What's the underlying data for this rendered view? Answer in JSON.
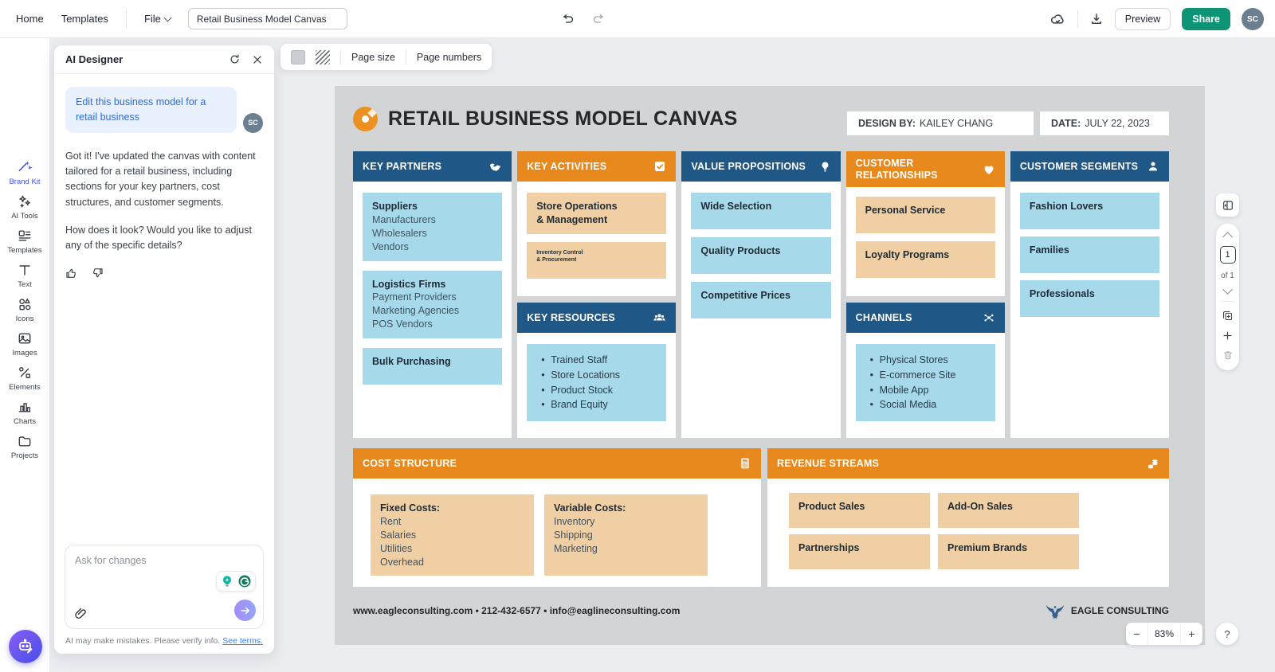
{
  "topbar": {
    "home": "Home",
    "templates": "Templates",
    "file": "File",
    "doc_title": "Retail Business Model Canvas",
    "preview": "Preview",
    "share": "Share",
    "avatar_initials": "SC"
  },
  "sidebar": {
    "items": [
      {
        "label": "Brand Kit"
      },
      {
        "label": "AI Tools"
      },
      {
        "label": "Templates"
      },
      {
        "label": "Text"
      },
      {
        "label": "Icons"
      },
      {
        "label": "Images"
      },
      {
        "label": "Elements"
      },
      {
        "label": "Charts"
      },
      {
        "label": "Projects"
      }
    ]
  },
  "ai_panel": {
    "title": "AI Designer",
    "user_message": "Edit this business model for a retail business",
    "user_avatar": "SC",
    "ai_paragraph1": "Got it! I've updated the canvas with content tailored for a retail business, including sections for your key partners, cost structures, and customer segments.",
    "ai_paragraph2": "How does it look? Would you like to adjust any of the specific details?",
    "input_placeholder": "Ask for changes",
    "disclaimer": "AI may make mistakes. Please verify info. ",
    "terms_link": "See terms."
  },
  "canvas_toolbar": {
    "page_size": "Page size",
    "page_numbers": "Page numbers"
  },
  "canvas": {
    "title": "RETAIL BUSINESS MODEL CANVAS",
    "design_by_label": "DESIGN BY:",
    "design_by_value": "KAILEY CHANG",
    "date_label": "DATE:",
    "date_value": "JULY 22, 2023",
    "key_partners": {
      "header": "KEY PARTNERS",
      "cards": [
        {
          "title": "Suppliers",
          "body": "Manufacturers\nWholesalers\nVendors"
        },
        {
          "title": "Logistics Firms",
          "body": "Payment Providers\nMarketing Agencies\nPOS Vendors"
        },
        {
          "title": "Bulk Purchasing",
          "body": ""
        }
      ]
    },
    "key_activities": {
      "header": "KEY ACTIVITIES",
      "cards": [
        {
          "title": "Store Operations\n& Management"
        },
        {
          "title": "Inventory Control\n& Procurement"
        }
      ]
    },
    "key_resources": {
      "header": "KEY RESOURCES",
      "bullets": [
        "Trained Staff",
        "Store Locations",
        "Product Stock",
        "Brand Equity"
      ]
    },
    "value_propositions": {
      "header": "VALUE PROPOSITIONS",
      "cards": [
        {
          "title": "Wide Selection"
        },
        {
          "title": "Quality Products"
        },
        {
          "title": "Competitive Prices"
        }
      ]
    },
    "customer_relationships": {
      "header": "CUSTOMER RELATIONSHIPS",
      "cards": [
        {
          "title": "Personal Service"
        },
        {
          "title": "Loyalty Programs"
        }
      ]
    },
    "channels": {
      "header": "CHANNELS",
      "bullets": [
        "Physical Stores",
        "E-commerce Site",
        "Mobile App",
        "Social Media"
      ]
    },
    "customer_segments": {
      "header": "CUSTOMER SEGMENTS",
      "cards": [
        {
          "title": "Fashion Lovers"
        },
        {
          "title": "Families"
        },
        {
          "title": "Professionals"
        }
      ]
    },
    "cost_structure": {
      "header": "COST STRUCTURE",
      "cards": [
        {
          "title": "Fixed Costs:",
          "body": "Rent\nSalaries\nUtilities\nOverhead"
        },
        {
          "title": "Variable Costs:",
          "body": "Inventory\nShipping\nMarketing"
        }
      ]
    },
    "revenue_streams": {
      "header": "REVENUE STREAMS",
      "cards": [
        {
          "title": "Product Sales"
        },
        {
          "title": "Add-On Sales"
        },
        {
          "title": "Partnerships"
        },
        {
          "title": "Premium Brands"
        }
      ]
    },
    "footer": {
      "contact": "www.eagleconsulting.com • 212-432-6577 • info@eaglineconsulting.com",
      "brand": "EAGLE CONSULTING"
    }
  },
  "page_controls": {
    "current": "1",
    "total": "of 1"
  },
  "zoom_controls": {
    "minus": "−",
    "level": "83%",
    "plus": "+"
  },
  "colors": {
    "header_blue": "#1F5787",
    "header_orange": "#E8891D",
    "card_blue": "#A6DAEB",
    "card_tan": "#F1CFA4",
    "share_green": "#0C9475",
    "active_nav_blue": "#4353E8"
  }
}
